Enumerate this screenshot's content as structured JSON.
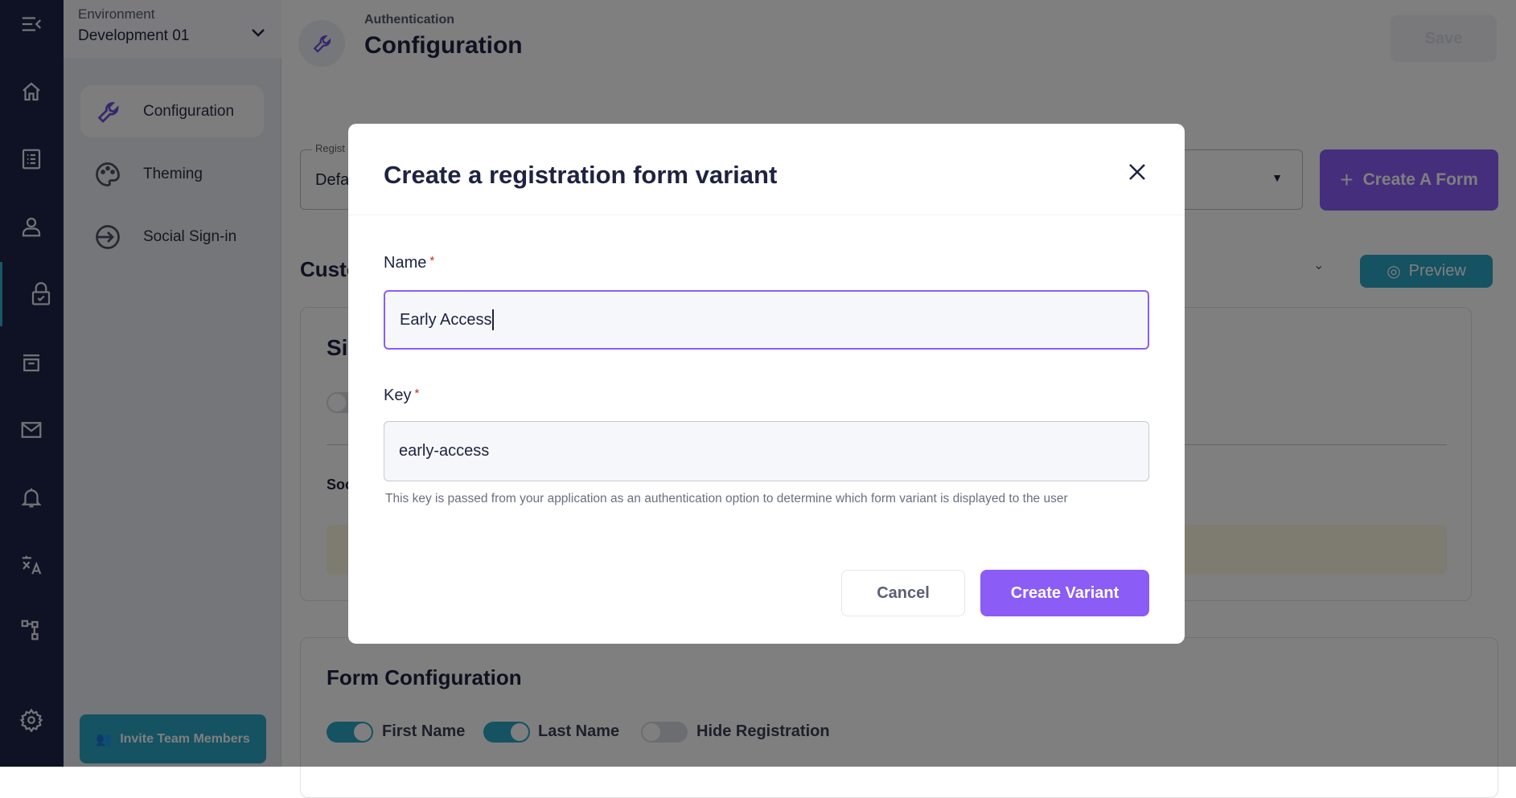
{
  "rail": {
    "items": [
      "menu-collapse",
      "home",
      "list",
      "user",
      "authentication",
      "archive",
      "mail",
      "bell",
      "translate",
      "hierarchy",
      "settings"
    ],
    "active": "authentication",
    "accent": "#2ab0d0"
  },
  "sidebar": {
    "env_label": "Environment",
    "env_value": "Development 01",
    "items": [
      {
        "label": "Configuration",
        "icon": "wrench",
        "selected": true
      },
      {
        "label": "Theming",
        "icon": "palette"
      },
      {
        "label": "Social Sign-in",
        "icon": "arrow-circle-right"
      }
    ],
    "invite_label": "Invite Team Members"
  },
  "header": {
    "breadcrumb": "Authentication",
    "title": "Configuration",
    "save_label": "Save"
  },
  "form_select": {
    "label": "Regist",
    "value": "Defa"
  },
  "create_form_label": "Create A Form",
  "custom_heading": "Custo",
  "preview_label": "Preview",
  "card1": {
    "heading": "Sig",
    "sub": "Soc"
  },
  "form_config": {
    "title": "Form Configuration",
    "toggles": [
      {
        "label": "First Name",
        "on": true
      },
      {
        "label": "Last Name",
        "on": true
      },
      {
        "label": "Hide Registration",
        "on": false
      }
    ]
  },
  "modal": {
    "title": "Create a registration form variant",
    "name_label": "Name",
    "name_value": "Early Access",
    "key_label": "Key",
    "key_value": "early-access",
    "required_mark": "*",
    "help": "This key is passed from your application as an authentication option to determine which form variant is displayed to the user",
    "cancel": "Cancel",
    "submit": "Create Variant",
    "accent": "#8b5cf6"
  }
}
